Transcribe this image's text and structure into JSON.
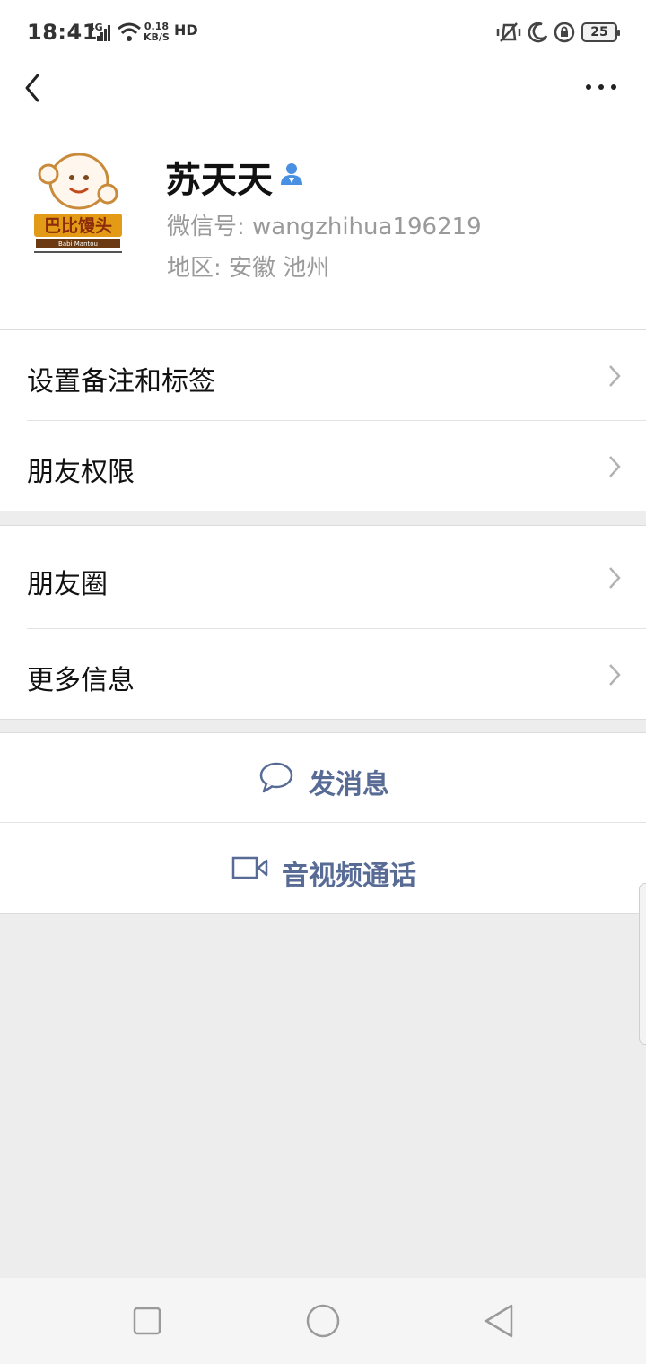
{
  "status_bar": {
    "time": "18:41",
    "network": "4G",
    "speed_value": "0.18",
    "speed_unit": "KB/S",
    "hd": "HD",
    "battery": "25"
  },
  "profile": {
    "name": "苏天天",
    "wechat_id": "微信号: wangzhihua196219",
    "region": "地区: 安徽  池州",
    "avatar_logo_text": "巴比馒头",
    "avatar_logo_sub": "Babi Mantou"
  },
  "menu": {
    "remark_tags": "设置备注和标签",
    "friend_permissions": "朋友权限",
    "moments": "朋友圈",
    "more_info": "更多信息"
  },
  "actions": {
    "send_message": "发消息",
    "video_call": "音视频通话"
  },
  "colors": {
    "link": "#576b95",
    "background": "#ededed",
    "verify": "#4a90e2"
  },
  "icons": [
    "back-arrow-icon",
    "more-icon",
    "verify-icon",
    "chevron-right-icon",
    "chat-bubble-icon",
    "video-camera-icon",
    "recent-apps-icon",
    "home-icon",
    "back-nav-icon"
  ]
}
